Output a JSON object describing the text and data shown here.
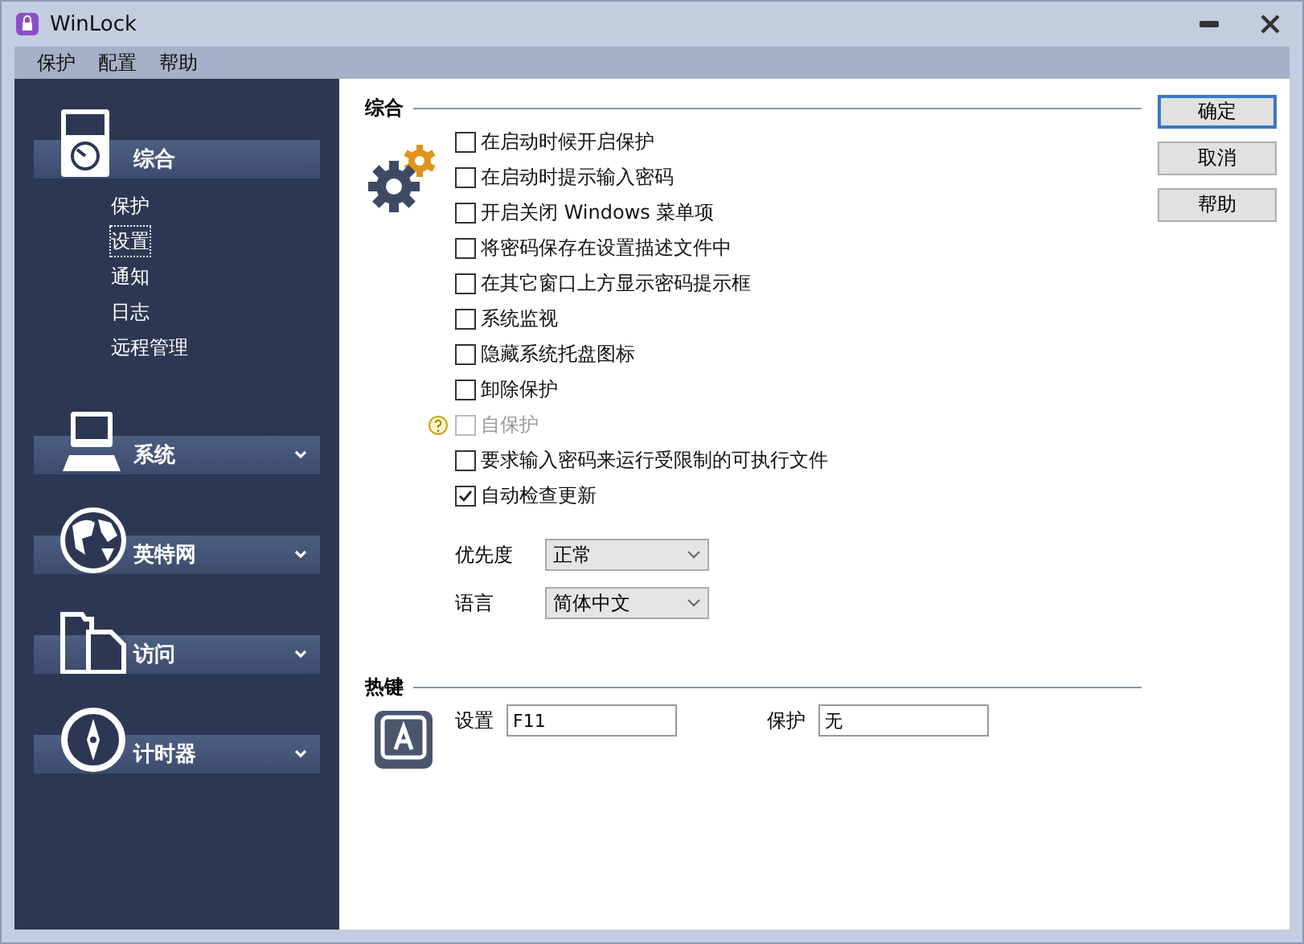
{
  "window": {
    "title": "WinLock"
  },
  "menu": [
    "保护",
    "配置",
    "帮助"
  ],
  "sidebar": {
    "sections": [
      {
        "label": "综合",
        "expanded": true,
        "items": [
          {
            "label": "保护",
            "selected": false
          },
          {
            "label": "设置",
            "selected": true
          },
          {
            "label": "通知",
            "selected": false
          },
          {
            "label": "日志",
            "selected": false
          },
          {
            "label": "远程管理",
            "selected": false
          }
        ]
      },
      {
        "label": "系统",
        "expanded": false
      },
      {
        "label": "英特网",
        "expanded": false
      },
      {
        "label": "访问",
        "expanded": false
      },
      {
        "label": "计时器",
        "expanded": false
      }
    ]
  },
  "general": {
    "title": "综合",
    "options": [
      {
        "label": "在启动时候开启保护",
        "checked": false,
        "disabled": false
      },
      {
        "label": "在启动时提示输入密码",
        "checked": false,
        "disabled": false
      },
      {
        "label": "开启关闭 Windows 菜单项",
        "checked": false,
        "disabled": false
      },
      {
        "label": "将密码保存在设置描述文件中",
        "checked": false,
        "disabled": false
      },
      {
        "label": "在其它窗口上方显示密码提示框",
        "checked": false,
        "disabled": false
      },
      {
        "label": "系统监视",
        "checked": false,
        "disabled": false
      },
      {
        "label": "隐藏系统托盘图标",
        "checked": false,
        "disabled": false
      },
      {
        "label": "卸除保护",
        "checked": false,
        "disabled": false
      },
      {
        "label": "自保护",
        "checked": false,
        "disabled": true,
        "help": true
      },
      {
        "label": "要求输入密码来运行受限制的可执行文件",
        "checked": false,
        "disabled": false
      },
      {
        "label": "自动检查更新",
        "checked": true,
        "disabled": false
      }
    ],
    "selects": [
      {
        "label": "优先度",
        "value": "正常"
      },
      {
        "label": "语言",
        "value": "简体中文"
      }
    ]
  },
  "hotkeys": {
    "title": "热键",
    "fields": [
      {
        "label": "设置",
        "value": "F11"
      },
      {
        "label": "保护",
        "value": "无"
      }
    ]
  },
  "buttons": [
    {
      "label": "确定",
      "default": true
    },
    {
      "label": "取消",
      "default": false
    },
    {
      "label": "帮助",
      "default": false
    }
  ]
}
